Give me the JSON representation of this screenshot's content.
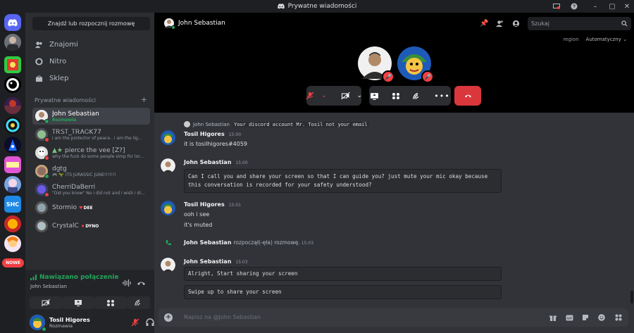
{
  "window": {
    "title": "Prywatne wiadomości"
  },
  "sidebar": {
    "search_button": "Znajdź lub rozpocznij rozmowę",
    "nav": [
      {
        "label": "Znajomi",
        "icon": "friends-icon"
      },
      {
        "label": "Nitro",
        "icon": "nitro-icon"
      },
      {
        "label": "Sklep",
        "icon": "shop-icon"
      }
    ],
    "dm_header": "Prywatne wiadomości",
    "dm_add": "+",
    "dms": [
      {
        "name": "John Sebastian",
        "sub": "Rozmawia",
        "status": "online",
        "selected": true
      },
      {
        "name": "ᎢᎡᏚᎢ_ᎢᎡᎪᏟK77",
        "sub": "i am the protector of peace.. i am the lig...",
        "status": "dnd"
      },
      {
        "name": "pierce the vee [Z?]",
        "sub": "why the fuck do some people simp for lor...",
        "status": "dnd"
      },
      {
        "name": "dgtg",
        "sub": "ITS JURASSIC JUNE!!!!!!!",
        "status": "online"
      },
      {
        "name": "CherriDaBerri",
        "sub": "\"Did you know\" No i did not and i wish i di...",
        "status": "dnd"
      },
      {
        "name": "Stormio",
        "badge": "DEE",
        "status": "offline"
      },
      {
        "name": "CrystalC",
        "badge": "DYNO",
        "status": "offline"
      }
    ],
    "new_badge": "NOWE"
  },
  "voice_panel": {
    "status": "Nawiązano połączenie",
    "channel": "John Sebastian"
  },
  "user_panel": {
    "name": "Tosil Higores",
    "status": "Rozmawia"
  },
  "header": {
    "name": "John Sebastian",
    "search_placeholder": "Szukaj",
    "region_label": "region",
    "region_value": "Automatyczny"
  },
  "messages": {
    "reply_author": "John Sebastian",
    "reply_text": "Your discord account Mr. Tosil not your email",
    "groups": [
      {
        "author": "Tosil Higores",
        "time": "15:00",
        "lines": [
          "it is tosilhigores#4059"
        ]
      },
      {
        "author": "John Sebastian",
        "time": "15:00",
        "code": "Can I call you and share your screen so that I can guide you? just mute your mic okay because this conversation is recorded for your safety understood?"
      },
      {
        "author": "Tosil Higores",
        "time": "15:01",
        "lines": [
          "ooh i see",
          "it's muted"
        ]
      },
      {
        "author": "John Sebastian",
        "call_text": "rozpoczął(-ęła) rozmowę.",
        "time": "15:03"
      },
      {
        "author": "John Sebastian",
        "time": "15:03",
        "code1": "Alright, Start sharing your screen",
        "code2": "Swipe up to share your screen"
      }
    ]
  },
  "composer": {
    "placeholder": "Napisz na @John Sebastian"
  },
  "colors": {
    "accent": "#5865f2",
    "green": "#23a55a",
    "red": "#f23f43",
    "bg": "#313338"
  }
}
